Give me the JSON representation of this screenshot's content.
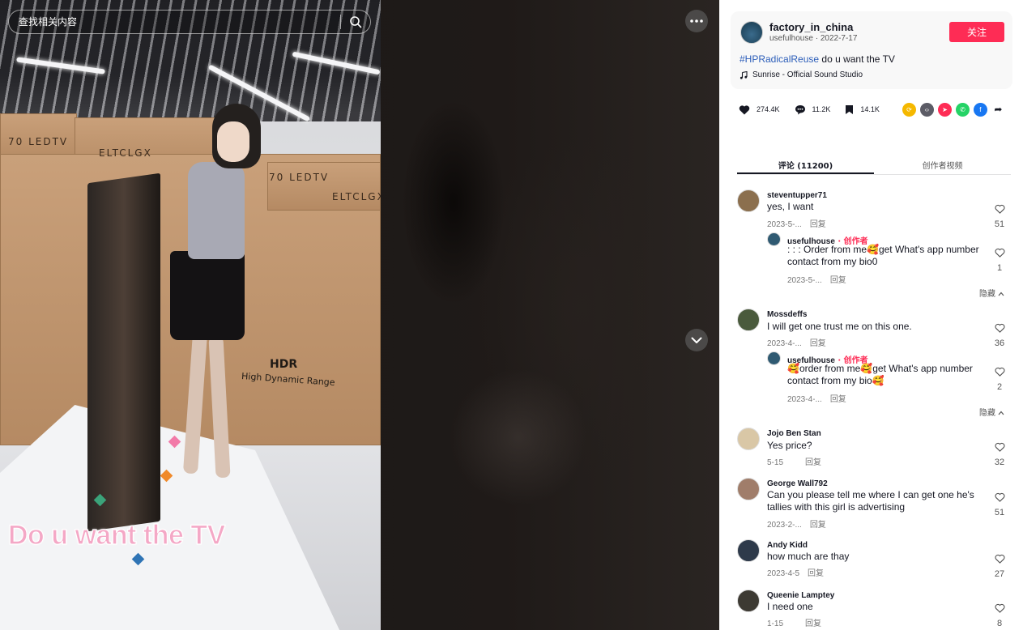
{
  "search": {
    "placeholder": "查找相关内容"
  },
  "video": {
    "caption": "Do u want the TV",
    "box_labels": [
      "70 LEDTV",
      "ELTCLGX",
      "70 LEDTV",
      "ELTCLGX"
    ],
    "hdr_title": "HDR",
    "hdr_subtitle": "High Dynamic Range"
  },
  "author": {
    "name": "factory_in_china",
    "handle_date": "usefulhouse · 2022-7-17",
    "follow_label": "关注"
  },
  "post": {
    "hashtag": "#HPRadicalReuse",
    "text": " do u want the TV",
    "music": "Sunrise - Official Sound Studio"
  },
  "stats": {
    "likes": "274.4K",
    "comments": "11.2K",
    "saves": "14.1K"
  },
  "tabs": [
    {
      "label": "评论 (11200)"
    },
    {
      "label": "创作者视频"
    }
  ],
  "comments": [
    {
      "user": "steventupper71",
      "text": "yes, I want",
      "date": "2023-5-...",
      "reply": "回复",
      "likes": "51",
      "avatar_color": "#8b6f4e",
      "sub": {
        "user": "usefulhouse",
        "creator": " · 创作者",
        "text": ": : : Order from me🥰get What's app number contact from my bio0",
        "date": "2023-5-...",
        "reply": "回复",
        "likes": "1"
      },
      "hide": "隐藏"
    },
    {
      "user": "Mossdeffs",
      "text": "I will get one trust me on this one.",
      "date": "2023-4-...",
      "reply": "回复",
      "likes": "36",
      "avatar_color": "#4a5a3c",
      "sub": {
        "user": "usefulhouse",
        "creator": " · 创作者",
        "text": "🥰order from me🥰get What's app number contact from my bio🥰",
        "date": "2023-4-...",
        "reply": "回复",
        "likes": "2"
      },
      "hide": "隐藏"
    },
    {
      "user": "Jojo Ben Stan",
      "text": "Yes price?",
      "date": "5-15",
      "reply": "回复",
      "likes": "32",
      "avatar_color": "#d9c7a6"
    },
    {
      "user": "George Wall792",
      "text": "Can you please tell me where I can get one he's tallies with this girl is advertising",
      "date": "2023-2-...",
      "reply": "回复",
      "likes": "51",
      "avatar_color": "#a07d6a"
    },
    {
      "user": "Andy Kidd",
      "text": "how much are thay",
      "date": "2023-4-5",
      "reply": "回复",
      "likes": "27",
      "avatar_color": "#2e3a4a"
    },
    {
      "user": "Queenie Lamptey",
      "text": "I need one",
      "date": "1-15",
      "reply": "回复",
      "likes": "8",
      "avatar_color": "#3d3a33"
    }
  ],
  "colors": {
    "accent": "#fe2c55",
    "hashtag": "#2b5db9",
    "creator_tag": "#fe2c55"
  },
  "icons": [
    "search-icon",
    "more-icon",
    "chevron-down-icon",
    "heart-icon",
    "comment-icon",
    "bookmark-icon",
    "music-icon",
    "share-icons"
  ]
}
